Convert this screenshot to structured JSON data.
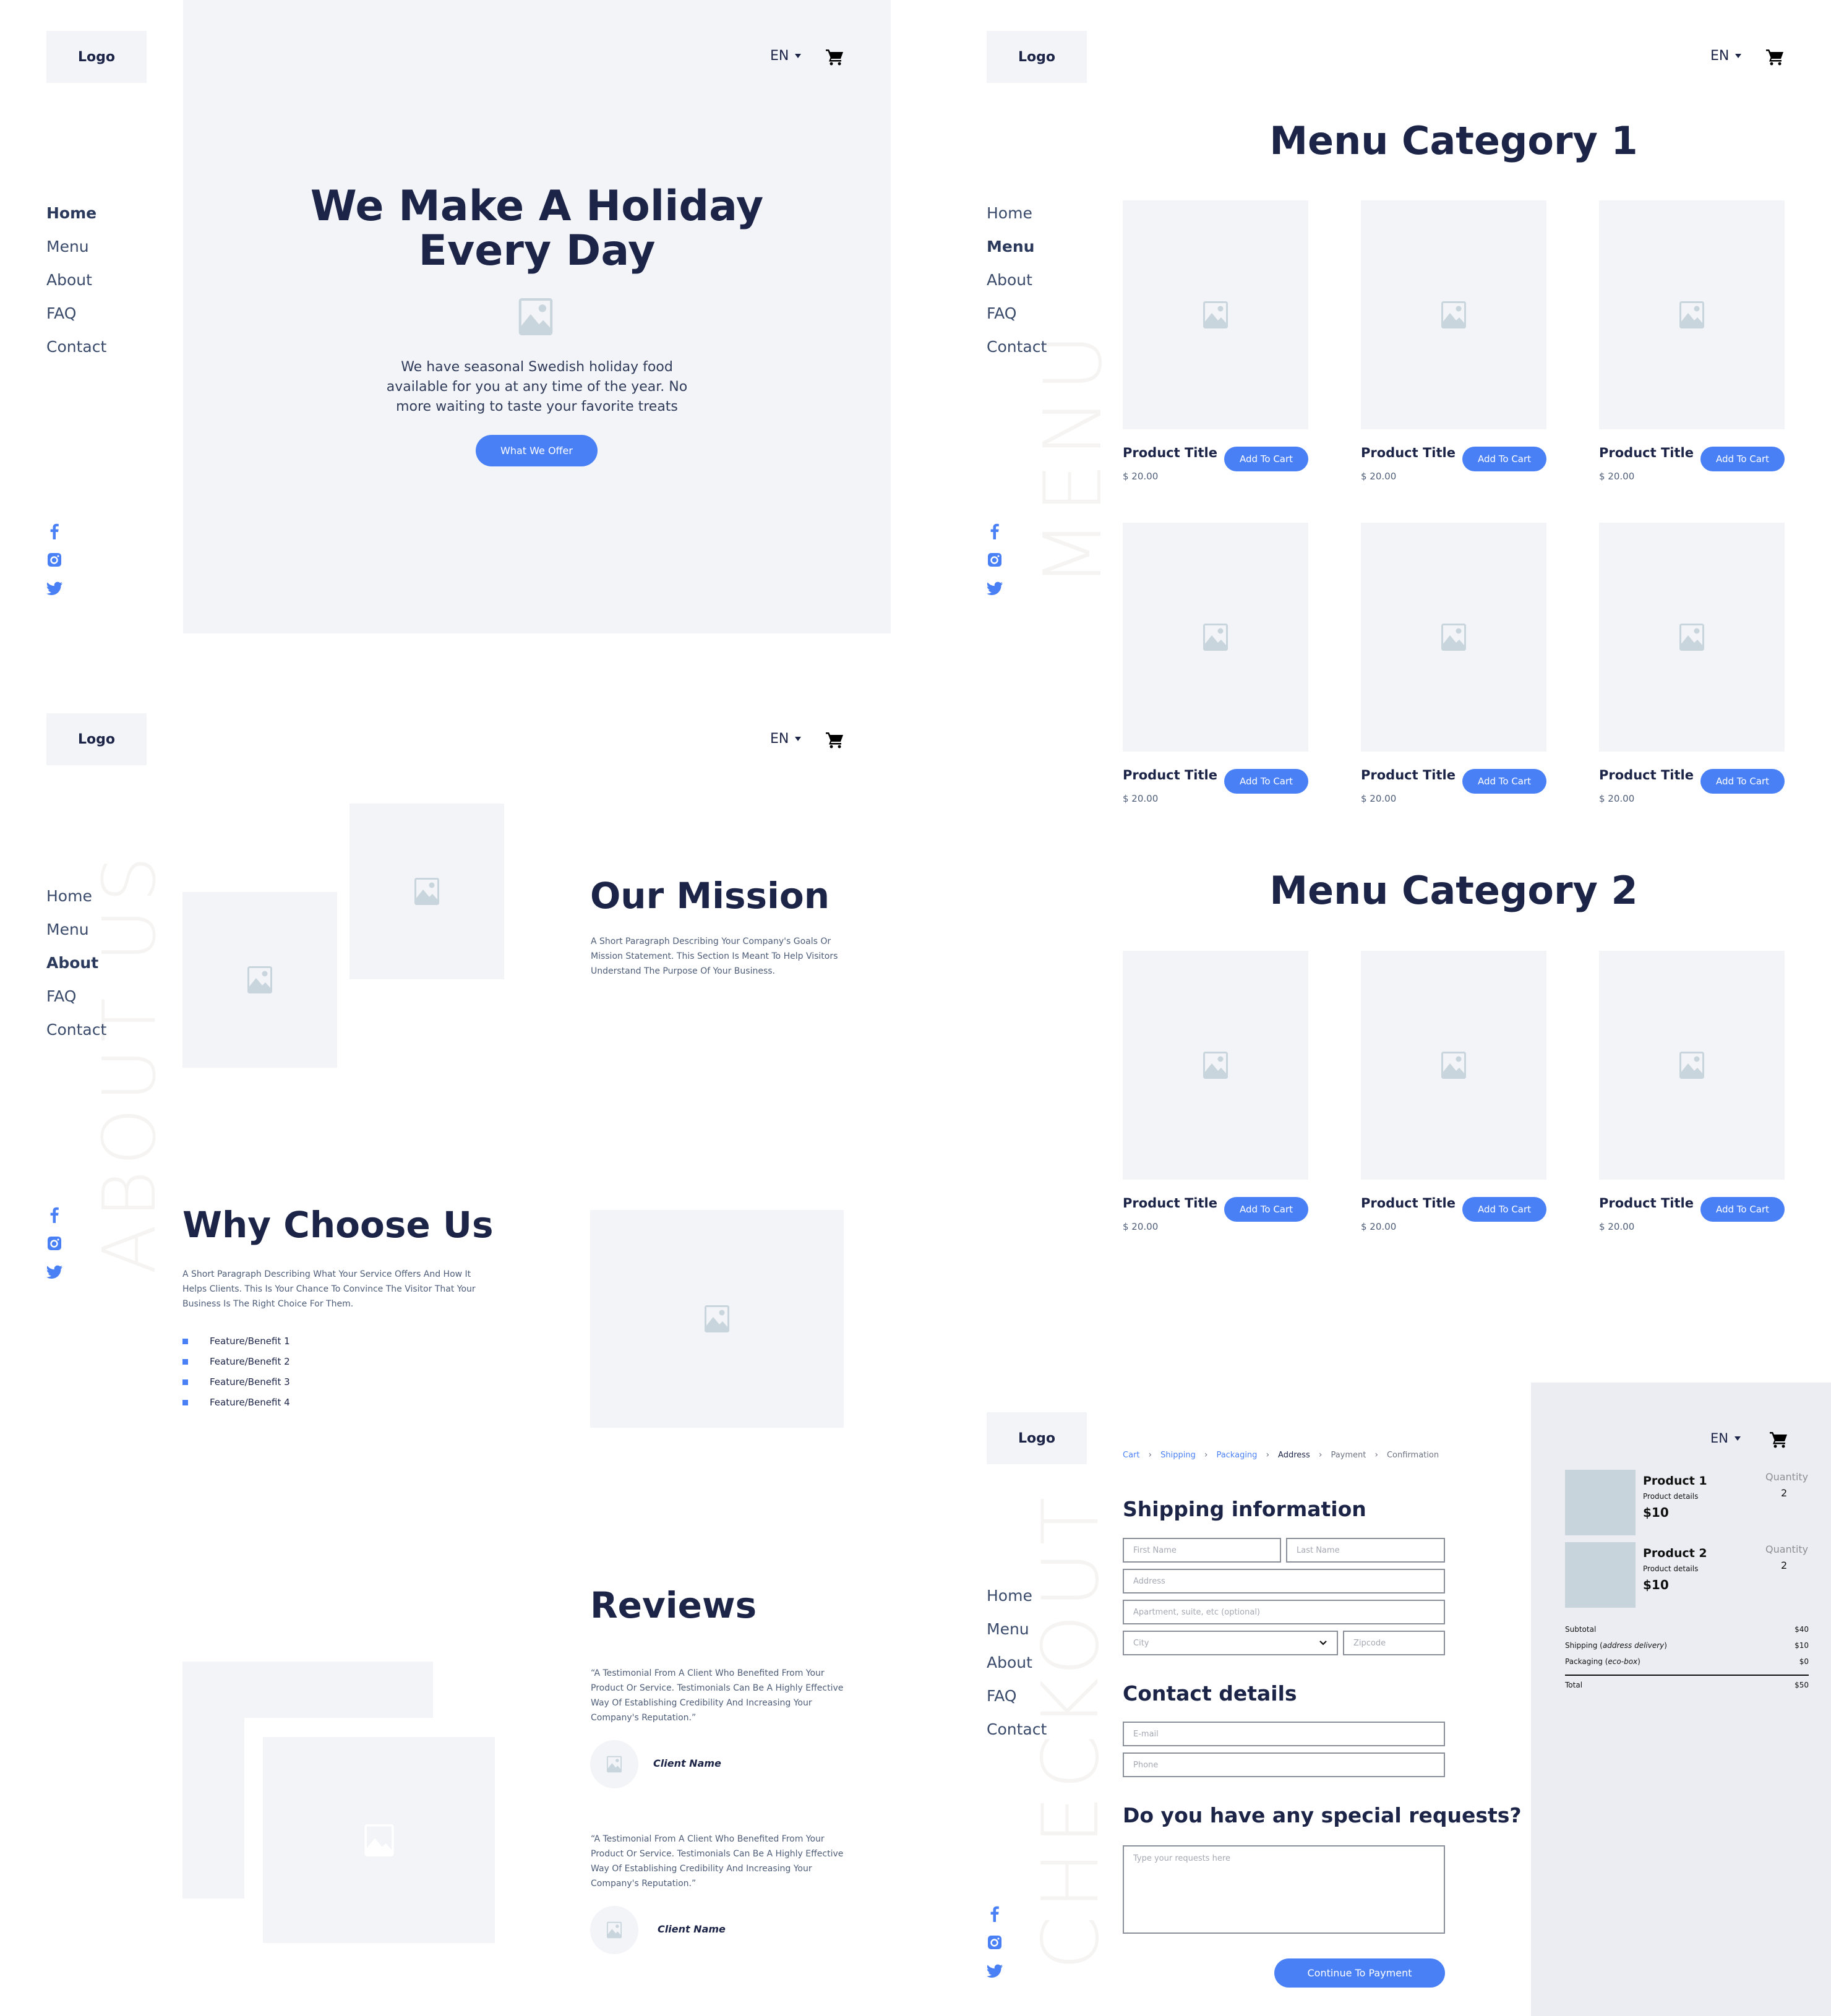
{
  "brand": {
    "logo": "Logo",
    "accent": "#4A80F5",
    "heading_color": "#1C2447"
  },
  "header": {
    "language": "EN",
    "cart_icon": "cart-icon",
    "caret_icon": "caret-down-icon"
  },
  "nav": {
    "items": [
      "Home",
      "Menu",
      "About",
      "FAQ",
      "Contact"
    ]
  },
  "social": [
    "facebook-icon",
    "instagram-icon",
    "twitter-icon"
  ],
  "home": {
    "title_line1": "We Make A Holiday",
    "title_line2": "Every Day",
    "description": "We have seasonal Swedish holiday food available for you at any time of the year. No more waiting to taste your favorite treats",
    "cta": "What We Offer",
    "active_nav": "Home"
  },
  "menu": {
    "watermark": "MENU",
    "active_nav": "Menu",
    "categories": [
      {
        "title": "Menu Category 1",
        "products": [
          {
            "title": "Product Title",
            "price": "$ 20.00",
            "button": "Add To Cart"
          },
          {
            "title": "Product Title",
            "price": "$ 20.00",
            "button": "Add To Cart"
          },
          {
            "title": "Product Title",
            "price": "$ 20.00",
            "button": "Add To Cart"
          },
          {
            "title": "Product Title",
            "price": "$ 20.00",
            "button": "Add To Cart"
          },
          {
            "title": "Product Title",
            "price": "$ 20.00",
            "button": "Add To Cart"
          },
          {
            "title": "Product Title",
            "price": "$ 20.00",
            "button": "Add To Cart"
          }
        ]
      },
      {
        "title": "Menu Category 2",
        "products": [
          {
            "title": "Product Title",
            "price": "$ 20.00",
            "button": "Add To Cart"
          },
          {
            "title": "Product Title",
            "price": "$ 20.00",
            "button": "Add To Cart"
          },
          {
            "title": "Product Title",
            "price": "$ 20.00",
            "button": "Add To Cart"
          }
        ]
      }
    ]
  },
  "about": {
    "watermark": "ABOUT US",
    "active_nav": "About",
    "mission_title": "Our Mission",
    "mission_text": "A Short Paragraph Describing Your Company's Goals Or Mission Statement. This Section Is Meant To Help Visitors Understand The Purpose Of Your Business.",
    "why_title": "Why Choose Us",
    "why_text": "A Short Paragraph Describing What Your Service Offers And How It Helps Clients. This Is Your Chance To Convince The Visitor That Your Business Is The Right Choice For Them.",
    "features": [
      "Feature/Benefit 1",
      "Feature/Benefit 2",
      "Feature/Benefit 3",
      "Feature/Benefit 4"
    ],
    "reviews_title": "Reviews",
    "reviews": [
      {
        "quote": "“A Testimonial From A Client Who Benefited From Your Product Or Service. Testimonials Can Be A Highly Effective Way Of Establishing Credibility And Increasing Your Company's Reputation.”",
        "client": "Client Name"
      },
      {
        "quote": "“A Testimonial From A Client Who Benefited From Your Product Or Service. Testimonials Can Be A Highly Effective Way Of Establishing Credibility And Increasing Your Company's Reputation.”",
        "client": "Client Name"
      }
    ]
  },
  "checkout": {
    "watermark": "CHECKOUT",
    "breadcrumb": [
      {
        "label": "Cart",
        "state": "done"
      },
      {
        "label": "Shipping",
        "state": "done"
      },
      {
        "label": "Packaging",
        "state": "done"
      },
      {
        "label": "Address",
        "state": "current"
      },
      {
        "label": "Payment",
        "state": "todo"
      },
      {
        "label": "Confirmation",
        "state": "todo"
      }
    ],
    "shipping_title": "Shipping information",
    "placeholders": {
      "first_name": "First Name",
      "last_name": "Last Name",
      "address": "Address",
      "apartment": "Apartment, suite, etc (optional)",
      "city": "City",
      "zipcode": "Zipcode",
      "email": "E-mail",
      "phone": "Phone",
      "requests": "Type your requests here"
    },
    "contact_title": "Contact details",
    "requests_title": "Do you have any special requests?",
    "continue": "Continue To Payment",
    "summary": {
      "items": [
        {
          "name": "Product 1",
          "details": "Product details",
          "price": "$10",
          "quantity_label": "Quantity",
          "quantity": "2"
        },
        {
          "name": "Product 2",
          "details": "Product details",
          "price": "$10",
          "quantity_label": "Quantity",
          "quantity": "2"
        }
      ],
      "subtotal_label": "Subtotal",
      "subtotal": "$40",
      "shipping_label": "Shipping",
      "shipping_note": "address delivery",
      "shipping": "$10",
      "packaging_label": "Packaging",
      "packaging_note": "eco-box",
      "packaging": "$0",
      "total_label": "Total",
      "total": "$50"
    }
  }
}
